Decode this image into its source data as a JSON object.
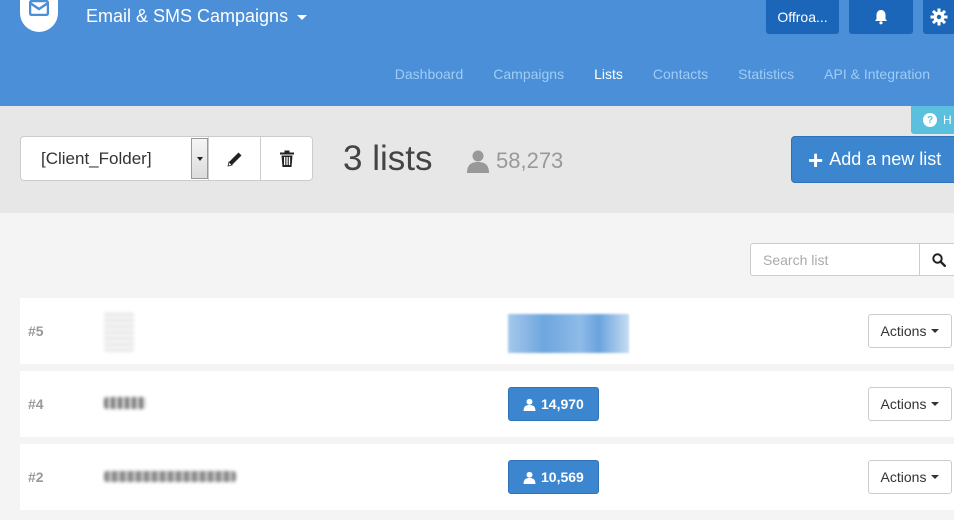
{
  "header": {
    "app_title": "Email & SMS Campaigns",
    "account_label": "Offroa...",
    "nav": [
      {
        "label": "Dashboard",
        "active": false
      },
      {
        "label": "Campaigns",
        "active": false
      },
      {
        "label": "Lists",
        "active": true
      },
      {
        "label": "Contacts",
        "active": false
      },
      {
        "label": "Statistics",
        "active": false
      },
      {
        "label": "API & Integration",
        "active": false
      }
    ],
    "help_label": "H"
  },
  "toolbar": {
    "folder_value": "[Client_Folder]",
    "list_count": "3 lists",
    "contact_total": "58,273",
    "add_list_label": "Add a new list"
  },
  "search": {
    "placeholder": "Search list"
  },
  "lists": [
    {
      "id": "#5",
      "count": "",
      "actions_label": "Actions"
    },
    {
      "id": "#4",
      "count": "14,970",
      "actions_label": "Actions"
    },
    {
      "id": "#2",
      "count": "10,569",
      "actions_label": "Actions"
    }
  ],
  "colors": {
    "header_bg": "#4a8fd8",
    "header_button": "#1b66b8",
    "primary": "#3c86d0",
    "help": "#5bc0de"
  },
  "icons": {
    "logo": "envelope-logo-icon",
    "notifications": "bell-icon",
    "settings": "gear-icon",
    "edit": "pencil-icon",
    "delete": "trash-icon",
    "contacts": "user-icon",
    "search": "search-icon",
    "add": "plus-icon"
  }
}
